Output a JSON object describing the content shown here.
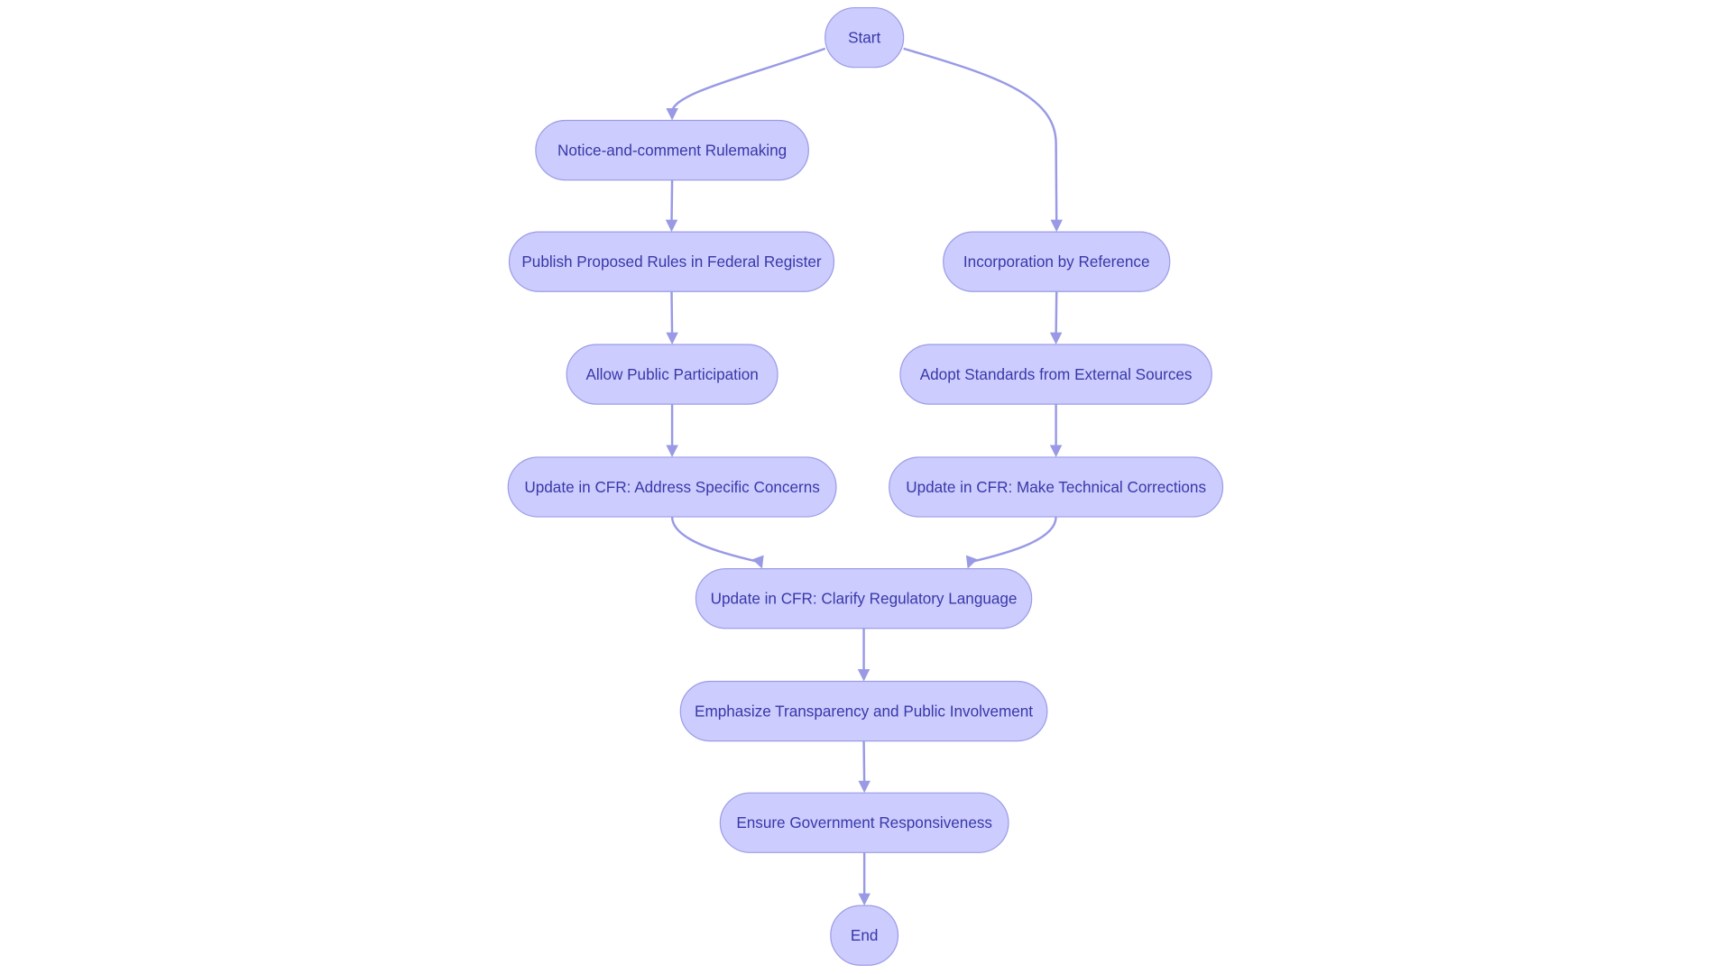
{
  "diagram": {
    "type": "flowchart",
    "colors": {
      "node_fill": "#ccccff",
      "node_stroke": "#9c9ce6",
      "edge": "#9999e6",
      "text": "#3838a8"
    },
    "nodes": {
      "start": "Start",
      "notice": "Notice-and-comment Rulemaking",
      "publish": "Publish Proposed Rules in Federal Register",
      "allow": "Allow Public Participation",
      "update_concerns": "Update in CFR: Address Specific Concerns",
      "incorporation": "Incorporation by Reference",
      "adopt": "Adopt Standards from External Sources",
      "update_technical": "Update in CFR: Make Technical Corrections",
      "clarify": "Update in CFR: Clarify Regulatory Language",
      "emphasize": "Emphasize Transparency and Public Involvement",
      "ensure": "Ensure Government Responsiveness",
      "end": "End"
    },
    "edges": [
      [
        "start",
        "notice"
      ],
      [
        "start",
        "incorporation"
      ],
      [
        "notice",
        "publish"
      ],
      [
        "publish",
        "allow"
      ],
      [
        "allow",
        "update_concerns"
      ],
      [
        "incorporation",
        "adopt"
      ],
      [
        "adopt",
        "update_technical"
      ],
      [
        "update_concerns",
        "clarify"
      ],
      [
        "update_technical",
        "clarify"
      ],
      [
        "clarify",
        "emphasize"
      ],
      [
        "emphasize",
        "ensure"
      ],
      [
        "ensure",
        "end"
      ]
    ]
  }
}
